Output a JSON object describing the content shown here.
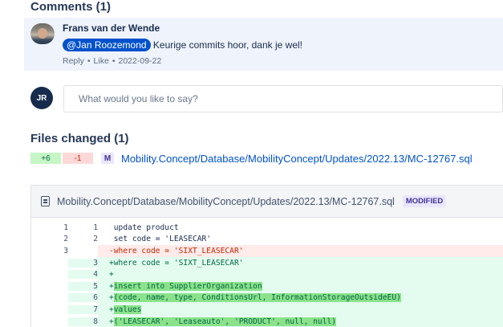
{
  "comments": {
    "title": "Comments (1)",
    "items": [
      {
        "author": "Frans van der Wende",
        "mention": "@Jan Roozemond",
        "text": " Keurige commits hoor, dank je wel!",
        "reply_label": "Reply",
        "like_label": "Like",
        "date": "2022-09-22"
      }
    ]
  },
  "reply": {
    "avatar_initials": "JR",
    "placeholder": "What would you like to say?"
  },
  "files": {
    "title": "Files changed (1)",
    "items": [
      {
        "additions": "+6",
        "deletions": "-1",
        "status_letter": "M",
        "path": "Mobility.Concept/Database/MobilityConcept/Updates/2022.13/MC-12767.sql"
      }
    ]
  },
  "diff": {
    "path": "Mobility.Concept/Database/MobilityConcept/Updates/2022.13/MC-12767.sql",
    "status": "MODIFIED",
    "lines": [
      {
        "old": "1",
        "new": "1",
        "type": "context",
        "text": " update product"
      },
      {
        "old": "2",
        "new": "2",
        "type": "context",
        "text": " set code = 'LEASECAR'"
      },
      {
        "old": "3",
        "new": "",
        "type": "removed",
        "text": "-where code = 'SIXT_LEASECAR'"
      },
      {
        "old": "",
        "new": "3",
        "type": "added",
        "text": "+where code = 'SIXT_LEASECAR'"
      },
      {
        "old": "",
        "new": "4",
        "type": "added",
        "text": "+"
      },
      {
        "old": "",
        "new": "5",
        "type": "added",
        "prefix": "+",
        "text": "insert into SupplierOrganization"
      },
      {
        "old": "",
        "new": "6",
        "type": "added",
        "prefix": "+",
        "text": "(code, name, type, ConditionsUrl, InformationStorageOutsideEU)"
      },
      {
        "old": "",
        "new": "7",
        "type": "added",
        "prefix": "+",
        "text": "values"
      },
      {
        "old": "",
        "new": "8",
        "type": "added",
        "prefix": "+",
        "text": "('LEASECAR', 'Leaseauto', 'PRODUCT', null, null)"
      }
    ]
  },
  "colors": {
    "mention_bg": "#0052cc",
    "added_bg": "#e3fcef",
    "removed_bg": "#ffebe9",
    "highlight": "#8be28b"
  }
}
